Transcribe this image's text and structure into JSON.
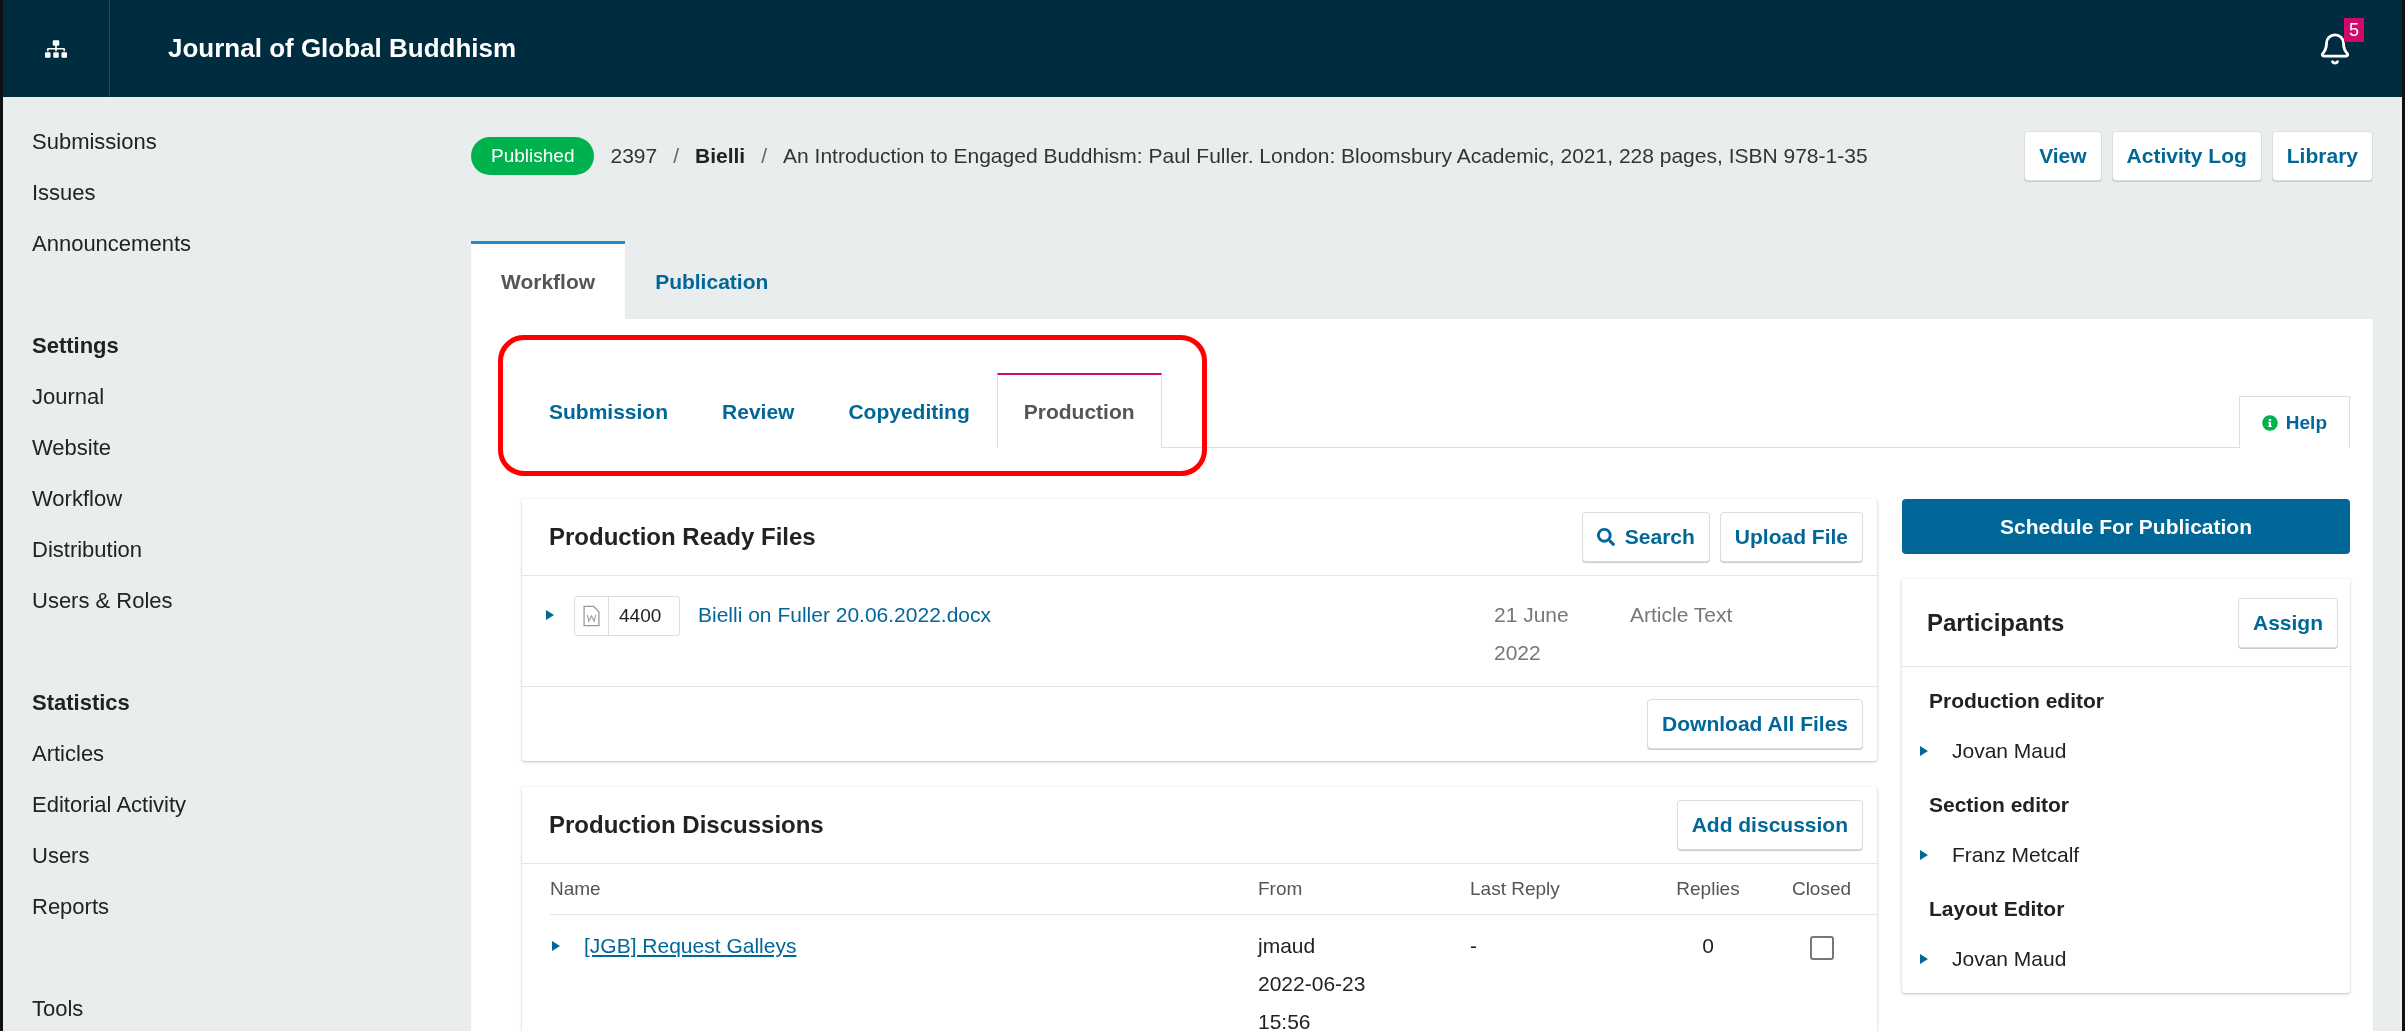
{
  "header": {
    "title": "Journal of Global Buddhism",
    "notifications": "5"
  },
  "sidebar": {
    "groups": [
      {
        "items": [
          "Submissions",
          "Issues",
          "Announcements"
        ]
      },
      {
        "heading": "Settings",
        "items": [
          "Journal",
          "Website",
          "Workflow",
          "Distribution",
          "Users & Roles"
        ]
      },
      {
        "heading": "Statistics",
        "items": [
          "Articles",
          "Editorial Activity",
          "Users",
          "Reports"
        ]
      },
      {
        "items": [
          "Tools"
        ]
      }
    ]
  },
  "submission": {
    "status": "Published",
    "id": "2397",
    "separators": [
      "/",
      "/"
    ],
    "author": "Bielli",
    "title": "An Introduction to Engaged Buddhism: Paul Fuller. London: Bloomsbury Academic, 2021, 228 pages, ISBN 978-1-35",
    "actions": [
      "View",
      "Activity Log",
      "Library"
    ]
  },
  "tabs": [
    {
      "label": "Workflow",
      "selected": true
    },
    {
      "label": "Publication",
      "selected": false
    }
  ],
  "stage_tabs": {
    "highlighted": true,
    "items": [
      {
        "label": "Submission",
        "selected": false
      },
      {
        "label": "Review",
        "selected": false
      },
      {
        "label": "Copyediting",
        "selected": false
      },
      {
        "label": "Production",
        "selected": true
      }
    ]
  },
  "help": "Help",
  "production_files": {
    "title": "Production Ready Files",
    "actions": [
      {
        "label": "Search",
        "kind": "search"
      },
      {
        "label": "Upload File",
        "kind": "plain"
      }
    ],
    "files": [
      {
        "id": "4400",
        "name": "Bielli on Fuller 20.06.2022.docx",
        "date": "21 June 2022",
        "type": "Article Text"
      }
    ],
    "footer_action": "Download All Files"
  },
  "discussions": {
    "title": "Production Discussions",
    "action": "Add discussion",
    "columns": [
      "Name",
      "From",
      "Last Reply",
      "Replies",
      "Closed"
    ],
    "rows": [
      {
        "name": "[JGB] Request Galleys",
        "from": "jmaud",
        "date": "2022-06-23",
        "time": "15:56",
        "last_reply": "-",
        "replies": "0",
        "closed": false
      }
    ]
  },
  "schedule_button": "Schedule For Publication",
  "participants": {
    "title": "Participants",
    "action": "Assign",
    "groups": [
      {
        "role": "Production editor",
        "people": [
          "Jovan Maud"
        ]
      },
      {
        "role": "Section editor",
        "people": [
          "Franz Metcalf"
        ]
      },
      {
        "role": "Layout Editor",
        "people": [
          "Jovan Maud"
        ]
      }
    ]
  }
}
